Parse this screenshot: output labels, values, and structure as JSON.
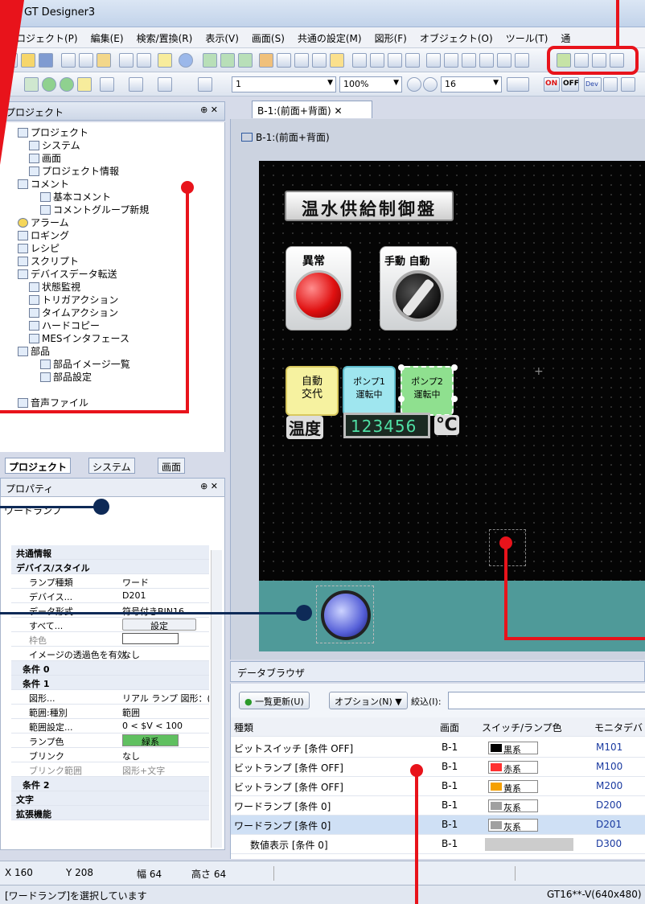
{
  "window": {
    "title": "GT Designer3"
  },
  "menu": [
    "プロジェクト(P)",
    "編集(E)",
    "検索/置換(R)",
    "表示(V)",
    "画面(S)",
    "共通の設定(M)",
    "図形(F)",
    "オブジェクト(O)",
    "ツール(T)",
    "通"
  ],
  "toolbar2": {
    "number_value": "1",
    "zoom": "100%",
    "grid_size": "16",
    "on_label": "ON",
    "off_label": "OFF",
    "dev_label": "Dev"
  },
  "project_panel": {
    "title": "プロジェクト",
    "tree": [
      "プロジェクト",
      "システム",
      "画面",
      "プロジェクト情報",
      "コメント",
      "基本コメント",
      "コメントグループ新規",
      "アラーム",
      "ロギング",
      "レシピ",
      "スクリプト",
      "デバイスデータ転送",
      "状態監視",
      "トリガアクション",
      "タイムアクション",
      "ハードコピー",
      "MESインタフェース",
      "部品",
      "部品イメージ一覧",
      "部品設定",
      "音声ファイル"
    ],
    "tabs": [
      "プロジェクト",
      "システム",
      "画面"
    ]
  },
  "property_panel": {
    "title": "プロパティ",
    "object_name": "ワードランプ",
    "rows": [
      {
        "k": "共通情報",
        "v": "",
        "cat": true
      },
      {
        "k": "デバイス/スタイル",
        "v": "",
        "cat": true
      },
      {
        "k": "ランプ種類",
        "v": "ワード"
      },
      {
        "k": "デバイス...",
        "v": "D201"
      },
      {
        "k": "データ形式",
        "v": "符号付きBIN16"
      },
      {
        "k": "すべて...",
        "v": "設定"
      },
      {
        "k": "枠色",
        "v": ""
      },
      {
        "k": "イメージの透過色を有効",
        "v": "なし"
      },
      {
        "k": "条件 0",
        "v": "",
        "cat": true
      },
      {
        "k": "条件 1",
        "v": "",
        "cat": true
      },
      {
        "k": "図形...",
        "v": "リアル ランプ 図形：("
      },
      {
        "k": "範囲:種別",
        "v": "範囲"
      },
      {
        "k": "範囲設定...",
        "v": "0 < $V < 100"
      },
      {
        "k": "ランプ色",
        "v": "緑系"
      },
      {
        "k": "ブリンク",
        "v": "なし"
      },
      {
        "k": "ブリンク範囲",
        "v": "図形+文字"
      },
      {
        "k": "条件 2",
        "v": "",
        "cat": true
      },
      {
        "k": "文字",
        "v": "",
        "cat": true
      },
      {
        "k": "拡張機能",
        "v": "",
        "cat": true
      }
    ]
  },
  "editor": {
    "tab_label": "B-1:(前面+背面)",
    "inner_label": "B-1:(前面+背面)",
    "hmi_title": "温水供給制御盤",
    "lamp_label": "異常",
    "switch_label": "手動  自動",
    "buttons": [
      {
        "line1": "自動",
        "line2": "交代"
      },
      {
        "line1": "ポンプ1",
        "line2": "運転中"
      },
      {
        "line1": "ポンプ2",
        "line2": "運転中"
      }
    ],
    "temp_label": "温度",
    "temp_value": "123456",
    "temp_unit": "℃"
  },
  "data_browser": {
    "title": "データブラウザ",
    "refresh": "一覧更新(U)",
    "options": "オプション(N) ▼",
    "filter_label": "絞込(I):",
    "headers": [
      "種類",
      "画面",
      "スイッチ/ランプ色",
      "モニタデバ"
    ],
    "rows": [
      {
        "type": "ビットスイッチ [条件 OFF]",
        "screen": "B-1",
        "color": "黒系",
        "swatch": "#000000",
        "device": "M101"
      },
      {
        "type": "ビットランプ [条件 OFF]",
        "screen": "B-1",
        "color": "赤系",
        "swatch": "#ff3030",
        "device": "M100"
      },
      {
        "type": "ビットランプ [条件 OFF]",
        "screen": "B-1",
        "color": "黄系",
        "swatch": "#f5a000",
        "device": "M200"
      },
      {
        "type": "ワードランプ [条件 0]",
        "screen": "B-1",
        "color": "灰系",
        "swatch": "#a0a0a0",
        "device": "D200"
      },
      {
        "type": "ワードランプ [条件 0]",
        "screen": "B-1",
        "color": "灰系",
        "swatch": "#a0a0a0",
        "device": "D201"
      },
      {
        "type": "数値表示 [条件 0]",
        "screen": "B-1",
        "color": "",
        "swatch": "",
        "device": "D300"
      }
    ]
  },
  "status": {
    "x": "X 160",
    "y": "Y 208",
    "w": "幅 64",
    "h": "高さ 64",
    "message": "[ワードランプ]を選択しています",
    "model": "GT16**-V(640x480)"
  },
  "colors": {
    "callout_red": "#e8131b",
    "callout_navy": "#0e2a57",
    "canvas_bg": "#050505"
  }
}
